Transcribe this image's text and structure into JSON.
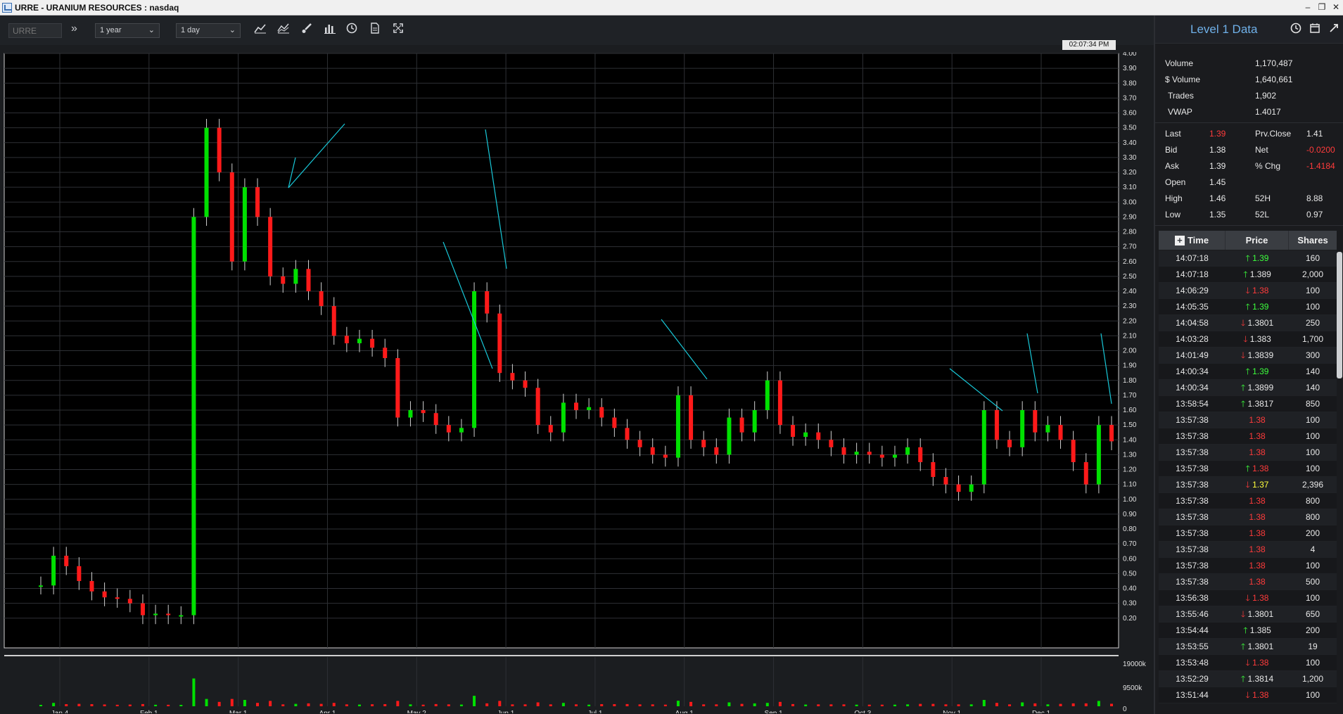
{
  "window": {
    "title": "URRE - URANIUM RESOURCES : nasdaq"
  },
  "toolbar": {
    "symbol_placeholder": "URRE",
    "range": "1 year",
    "interval": "1 day",
    "icons": [
      "line-chart-icon",
      "indicator-icon",
      "draw-brush-icon",
      "bar-chart-icon",
      "clock-icon",
      "document-icon",
      "fullscreen-icon"
    ]
  },
  "clock": "02:07:34 PM",
  "chart_data": {
    "type": "candlestick",
    "title": "",
    "price_axis": {
      "min": 0.0,
      "max": 4.0,
      "ticks": [
        "4.00",
        "3.90",
        "3.80",
        "3.70",
        "3.60",
        "3.50",
        "3.40",
        "3.30",
        "3.20",
        "3.10",
        "3.00",
        "2.90",
        "2.80",
        "2.70",
        "2.60",
        "2.50",
        "2.40",
        "2.30",
        "2.20",
        "2.10",
        "2.00",
        "1.90",
        "1.80",
        "1.70",
        "1.60",
        "1.50",
        "1.40",
        "1.30",
        "1.20",
        "1.10",
        "1.00",
        "0.90",
        "0.80",
        "0.70",
        "0.60",
        "0.50",
        "0.40",
        "0.30",
        "0.20"
      ]
    },
    "volume_axis": {
      "ticks": [
        "19000k",
        "9500k",
        "0"
      ]
    },
    "x_labels": [
      "Jan 4",
      "Feb 1",
      "Mar 1",
      "Apr 1",
      "May 2",
      "Jun 1",
      "Jul 1",
      "Aug 1",
      "Sep 1",
      "Oct 3",
      "Nov 1",
      "Dec 1"
    ],
    "grid": true,
    "colors": {
      "up": "#00e000",
      "down": "#ff1a1a",
      "annotation": "#18c8d8",
      "grid": "#2e3035",
      "background": "#000000"
    },
    "close_series": [
      0.42,
      0.62,
      0.55,
      0.45,
      0.38,
      0.34,
      0.33,
      0.3,
      0.22,
      0.23,
      0.22,
      0.22,
      2.9,
      3.5,
      3.2,
      2.6,
      3.1,
      2.9,
      2.5,
      2.45,
      2.55,
      2.4,
      2.3,
      2.1,
      2.05,
      2.08,
      2.02,
      1.95,
      1.55,
      1.6,
      1.58,
      1.5,
      1.45,
      1.48,
      2.4,
      2.25,
      1.85,
      1.8,
      1.75,
      1.5,
      1.45,
      1.65,
      1.6,
      1.62,
      1.55,
      1.48,
      1.4,
      1.35,
      1.3,
      1.28,
      1.7,
      1.4,
      1.35,
      1.3,
      1.55,
      1.45,
      1.6,
      1.8,
      1.5,
      1.42,
      1.45,
      1.4,
      1.35,
      1.3,
      1.32,
      1.3,
      1.28,
      1.3,
      1.35,
      1.25,
      1.15,
      1.1,
      1.05,
      1.1,
      1.6,
      1.4,
      1.35,
      1.6,
      1.45,
      1.5,
      1.4,
      1.25,
      1.1,
      1.5,
      1.39
    ],
    "annotations": [
      {
        "label": "",
        "text": ""
      }
    ]
  },
  "level1": {
    "title": "Level 1 Data",
    "volume": {
      "label": "Volume",
      "value": "1,170,487"
    },
    "dollar_volume": {
      "label": "$ Volume",
      "value": "1,640,661"
    },
    "trades": {
      "label": "Trades",
      "value": "1,902"
    },
    "vwap": {
      "label": "VWAP",
      "value": "1.4017"
    },
    "last": {
      "label": "Last",
      "value": "1.39"
    },
    "prev_close": {
      "label": "Prv.Close",
      "value": "1.41"
    },
    "bid": {
      "label": "Bid",
      "value": "1.38"
    },
    "net": {
      "label": "Net",
      "value": "-0.0200"
    },
    "ask": {
      "label": "Ask",
      "value": "1.39"
    },
    "pct_chg": {
      "label": "% Chg",
      "value": "-1.4184"
    },
    "open": {
      "label": "Open",
      "value": "1.45"
    },
    "high": {
      "label": "High",
      "value": "1.46"
    },
    "h52": {
      "label": "52H",
      "value": "8.88"
    },
    "low": {
      "label": "Low",
      "value": "1.35"
    },
    "l52": {
      "label": "52L",
      "value": "0.97"
    }
  },
  "time_sales": {
    "headers": {
      "time": "Time",
      "price": "Price",
      "shares": "Shares"
    },
    "rows": [
      {
        "time": "14:07:18",
        "price": "1.39",
        "dir": "up",
        "shares": "160"
      },
      {
        "time": "14:07:18",
        "price": "1.389",
        "dir": "upw",
        "shares": "2,000"
      },
      {
        "time": "14:06:29",
        "price": "1.38",
        "dir": "dn",
        "shares": "100"
      },
      {
        "time": "14:05:35",
        "price": "1.39",
        "dir": "up",
        "shares": "100"
      },
      {
        "time": "14:04:58",
        "price": "1.3801",
        "dir": "dnw",
        "shares": "250"
      },
      {
        "time": "14:03:28",
        "price": "1.383",
        "dir": "dnw",
        "shares": "1,700"
      },
      {
        "time": "14:01:49",
        "price": "1.3839",
        "dir": "dnw",
        "shares": "300"
      },
      {
        "time": "14:00:34",
        "price": "1.39",
        "dir": "up",
        "shares": "140"
      },
      {
        "time": "14:00:34",
        "price": "1.3899",
        "dir": "upw",
        "shares": "140"
      },
      {
        "time": "13:58:54",
        "price": "1.3817",
        "dir": "upw",
        "shares": "850"
      },
      {
        "time": "13:57:38",
        "price": "1.38",
        "dir": "flat",
        "shares": "100"
      },
      {
        "time": "13:57:38",
        "price": "1.38",
        "dir": "flat",
        "shares": "100"
      },
      {
        "time": "13:57:38",
        "price": "1.38",
        "dir": "flat",
        "shares": "100"
      },
      {
        "time": "13:57:38",
        "price": "1.38",
        "dir": "upr",
        "shares": "100"
      },
      {
        "time": "13:57:38",
        "price": "1.37",
        "dir": "dny",
        "shares": "2,396"
      },
      {
        "time": "13:57:38",
        "price": "1.38",
        "dir": "flat",
        "shares": "800"
      },
      {
        "time": "13:57:38",
        "price": "1.38",
        "dir": "flat",
        "shares": "800"
      },
      {
        "time": "13:57:38",
        "price": "1.38",
        "dir": "flat",
        "shares": "200"
      },
      {
        "time": "13:57:38",
        "price": "1.38",
        "dir": "flat",
        "shares": "4"
      },
      {
        "time": "13:57:38",
        "price": "1.38",
        "dir": "flat",
        "shares": "100"
      },
      {
        "time": "13:57:38",
        "price": "1.38",
        "dir": "flat",
        "shares": "500"
      },
      {
        "time": "13:56:38",
        "price": "1.38",
        "dir": "dn",
        "shares": "100"
      },
      {
        "time": "13:55:46",
        "price": "1.3801",
        "dir": "dnw",
        "shares": "650"
      },
      {
        "time": "13:54:44",
        "price": "1.385",
        "dir": "upw",
        "shares": "200"
      },
      {
        "time": "13:53:55",
        "price": "1.3801",
        "dir": "upw",
        "shares": "19"
      },
      {
        "time": "13:53:48",
        "price": "1.38",
        "dir": "dn",
        "shares": "100"
      },
      {
        "time": "13:52:29",
        "price": "1.3814",
        "dir": "upw",
        "shares": "1,200"
      },
      {
        "time": "13:51:44",
        "price": "1.38",
        "dir": "dn",
        "shares": "100"
      }
    ]
  }
}
